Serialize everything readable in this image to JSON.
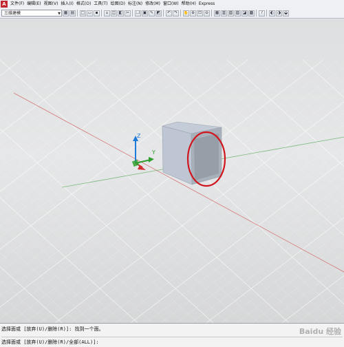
{
  "menubar": {
    "items": [
      "文件(F)",
      "编辑(E)",
      "视图(V)",
      "插入(I)",
      "格式(O)",
      "工具(T)",
      "绘图(D)",
      "标注(N)",
      "修改(M)",
      "窗口(W)",
      "帮助(H)",
      "Express"
    ]
  },
  "toolbar": {
    "workspace_value": "三维建模",
    "icons": [
      "layer-properties-icon",
      "layer-state-icon",
      "new-file-icon",
      "open-file-icon",
      "save-icon",
      "print-icon",
      "plot-preview-icon",
      "publish-icon",
      "cut-icon",
      "copy-icon",
      "paste-icon",
      "match-properties-icon",
      "block-editor-icon",
      "undo-icon",
      "redo-icon",
      "pan-icon",
      "zoom-realtime-icon",
      "zoom-window-icon",
      "zoom-previous-icon",
      "properties-icon",
      "design-center-icon",
      "tool-palettes-icon",
      "sheet-set-icon",
      "markup-icon",
      "quickcalc-icon",
      "help-icon",
      "extra-icon-1",
      "extra-icon-2",
      "extra-icon-3"
    ]
  },
  "viewport": {
    "axis_labels": {
      "z": "Z",
      "y": "Y"
    }
  },
  "command": {
    "history_line": "选择面或 [放弃(U)/删除(R)]: 找到一个面。",
    "prompt_line": "选择面或 [放弃(U)/删除(R)/全部(ALL)]:"
  },
  "watermark": "Baidu 经验",
  "colors": {
    "highlight_circle": "#d0151d",
    "x_axis": "#d04848",
    "y_axis": "#2e9e2e",
    "z_axis": "#1e7ad8"
  }
}
